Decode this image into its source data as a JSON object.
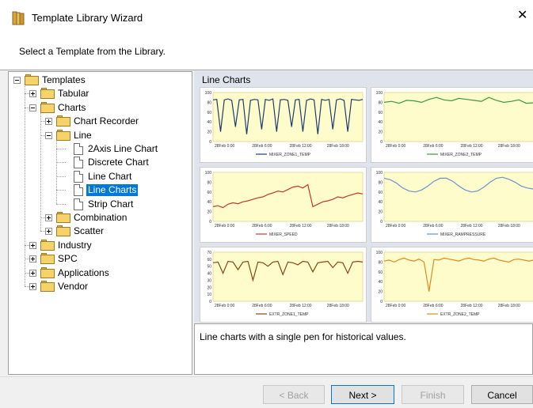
{
  "window": {
    "title": "Template Library Wizard",
    "close_glyph": "✕",
    "icon": "template-library-icon"
  },
  "header": {
    "instruction": "Select a Template from the Library."
  },
  "tree": {
    "nodes": [
      {
        "label": "Templates",
        "level": 0,
        "expander": "minus",
        "icon": "folder-icon"
      },
      {
        "label": "Tabular",
        "level": 1,
        "expander": "plus",
        "icon": "folder-icon"
      },
      {
        "label": "Charts",
        "level": 1,
        "expander": "minus",
        "icon": "folder-icon"
      },
      {
        "label": "Chart Recorder",
        "level": 2,
        "expander": "plus",
        "icon": "folder-icon"
      },
      {
        "label": "Line",
        "level": 2,
        "expander": "minus",
        "icon": "folder-icon"
      },
      {
        "label": "2Axis Line Chart",
        "level": 3,
        "expander": "none",
        "icon": "document-icon"
      },
      {
        "label": "Discrete Chart",
        "level": 3,
        "expander": "none",
        "icon": "document-icon"
      },
      {
        "label": "Line Chart",
        "level": 3,
        "expander": "none",
        "icon": "document-icon"
      },
      {
        "label": "Line Charts",
        "level": 3,
        "expander": "none",
        "icon": "document-icon",
        "selected": true
      },
      {
        "label": "Strip Chart",
        "level": 3,
        "expander": "none",
        "icon": "document-icon"
      },
      {
        "label": "Combination",
        "level": 2,
        "expander": "plus",
        "icon": "folder-icon"
      },
      {
        "label": "Scatter",
        "level": 2,
        "expander": "plus",
        "icon": "folder-icon"
      },
      {
        "label": "Industry",
        "level": 1,
        "expander": "plus",
        "icon": "folder-icon"
      },
      {
        "label": "SPC",
        "level": 1,
        "expander": "plus",
        "icon": "folder-icon"
      },
      {
        "label": "Applications",
        "level": 1,
        "expander": "plus",
        "icon": "folder-icon"
      },
      {
        "label": "Vendor",
        "level": 1,
        "expander": "plus",
        "icon": "folder-icon"
      }
    ]
  },
  "preview": {
    "title": "Line Charts",
    "description": "Line charts with a single pen for historical values.",
    "x_ticks": [
      "28Feb 0:00",
      "28Feb 6:00",
      "28Feb 12:00",
      "28Feb 18:00"
    ],
    "colors": {
      "plot_background": "#fffccc",
      "accent_border": "#e0dc9a"
    }
  },
  "chart_data": [
    {
      "type": "line",
      "title": "",
      "series": [
        {
          "name": "MIXER_ZONE1_TEMP",
          "color": "#1f3b73"
        }
      ],
      "ylim": [
        0,
        100
      ],
      "y_ticks": [
        "0",
        "20",
        "40",
        "60",
        "80",
        "100"
      ],
      "pattern": "square-dips",
      "x": [
        0,
        1,
        2,
        3,
        4,
        5,
        6,
        7,
        8,
        9,
        10,
        11,
        12,
        13,
        14,
        15,
        16,
        17,
        18,
        19,
        20,
        21,
        22,
        23,
        24,
        25,
        26,
        27,
        28,
        29,
        30,
        31,
        32,
        33,
        34,
        35,
        36,
        37,
        38,
        39,
        40
      ],
      "values": [
        85,
        86,
        20,
        85,
        87,
        84,
        30,
        85,
        86,
        15,
        84,
        86,
        85,
        25,
        86,
        84,
        87,
        20,
        85,
        86,
        84,
        30,
        85,
        86,
        20,
        84,
        87,
        85,
        15,
        86,
        84,
        86,
        25,
        85,
        87,
        84,
        20,
        86,
        85,
        84,
        86
      ]
    },
    {
      "type": "line",
      "title": "",
      "series": [
        {
          "name": "MIXER_ZONE2_TEMP",
          "color": "#3c9a3c"
        }
      ],
      "ylim": [
        0,
        100
      ],
      "y_ticks": [
        "0",
        "20",
        "40",
        "60",
        "80",
        "100"
      ],
      "x": [
        0,
        1,
        2,
        3,
        4,
        5,
        6,
        7,
        8,
        9,
        10,
        11,
        12,
        13,
        14,
        15,
        16,
        17,
        18,
        19,
        20
      ],
      "values": [
        80,
        82,
        78,
        84,
        83,
        80,
        86,
        90,
        85,
        83,
        88,
        86,
        84,
        82,
        90,
        84,
        80,
        82,
        85,
        78,
        79
      ]
    },
    {
      "type": "line",
      "title": "",
      "series": [
        {
          "name": "MIXER_SPEED",
          "color": "#c0392b"
        }
      ],
      "ylim": [
        0,
        100
      ],
      "y_ticks": [
        "0",
        "20",
        "40",
        "60",
        "80",
        "100"
      ],
      "x": [
        0,
        1,
        2,
        3,
        4,
        5,
        6,
        7,
        8,
        9,
        10,
        11,
        12,
        13,
        14,
        15,
        16,
        17,
        18,
        19,
        20,
        21,
        22,
        23,
        24,
        25,
        26,
        27,
        28,
        29,
        30
      ],
      "values": [
        30,
        32,
        28,
        35,
        38,
        36,
        40,
        42,
        45,
        48,
        50,
        55,
        58,
        62,
        60,
        65,
        70,
        72,
        68,
        75,
        30,
        35,
        40,
        42,
        45,
        50,
        48,
        52,
        55,
        58,
        56
      ]
    },
    {
      "type": "line",
      "title": "",
      "series": [
        {
          "name": "MIXER_RAMPRESSURE",
          "color": "#6a93d4"
        }
      ],
      "ylim": [
        0,
        100
      ],
      "y_ticks": [
        "0",
        "20",
        "40",
        "60",
        "80",
        "100"
      ],
      "x": [
        0,
        1,
        2,
        3,
        4,
        5,
        6,
        7,
        8,
        9,
        10,
        11,
        12,
        13,
        14,
        15,
        16,
        17,
        18,
        19,
        20,
        21,
        22,
        23,
        24
      ],
      "values": [
        88,
        85,
        78,
        68,
        62,
        60,
        64,
        72,
        82,
        88,
        88,
        82,
        72,
        64,
        60,
        62,
        70,
        80,
        88,
        90,
        86,
        80,
        72,
        68,
        66
      ]
    },
    {
      "type": "line",
      "title": "",
      "series": [
        {
          "name": "EXTR_ZONE1_TEMP",
          "color": "#8b4513"
        }
      ],
      "ylim": [
        0,
        70
      ],
      "y_ticks": [
        "0",
        "10",
        "20",
        "30",
        "40",
        "50",
        "60",
        "70"
      ],
      "x": [
        0,
        1,
        2,
        3,
        4,
        5,
        6,
        7,
        8,
        9,
        10,
        11,
        12,
        13,
        14,
        15,
        16,
        17,
        18,
        19,
        20,
        21,
        22,
        23,
        24,
        25,
        26,
        27,
        28,
        29,
        30
      ],
      "values": [
        55,
        56,
        40,
        57,
        56,
        45,
        56,
        57,
        30,
        56,
        55,
        50,
        56,
        57,
        38,
        56,
        55,
        52,
        57,
        56,
        42,
        55,
        56,
        57,
        48,
        56,
        55,
        40,
        56,
        57,
        56
      ]
    },
    {
      "type": "line",
      "title": "",
      "series": [
        {
          "name": "EXTR_ZONE2_TEMP",
          "color": "#e08a1e"
        }
      ],
      "ylim": [
        0,
        100
      ],
      "y_ticks": [
        "0",
        "20",
        "40",
        "60",
        "80",
        "100"
      ],
      "x": [
        0,
        1,
        2,
        3,
        4,
        5,
        6,
        7,
        8,
        9,
        10,
        11,
        12,
        13,
        14,
        15,
        16,
        17,
        18,
        19,
        20,
        21,
        22,
        23,
        24,
        25,
        26,
        27,
        28,
        29,
        30
      ],
      "values": [
        82,
        84,
        80,
        85,
        88,
        84,
        82,
        86,
        80,
        20,
        85,
        84,
        88,
        86,
        84,
        82,
        86,
        88,
        85,
        84,
        82,
        86,
        88,
        84,
        82,
        80,
        85,
        86,
        84,
        82,
        84
      ]
    }
  ],
  "buttons": {
    "back": "< Back",
    "next": "Next >",
    "finish": "Finish",
    "cancel": "Cancel"
  }
}
